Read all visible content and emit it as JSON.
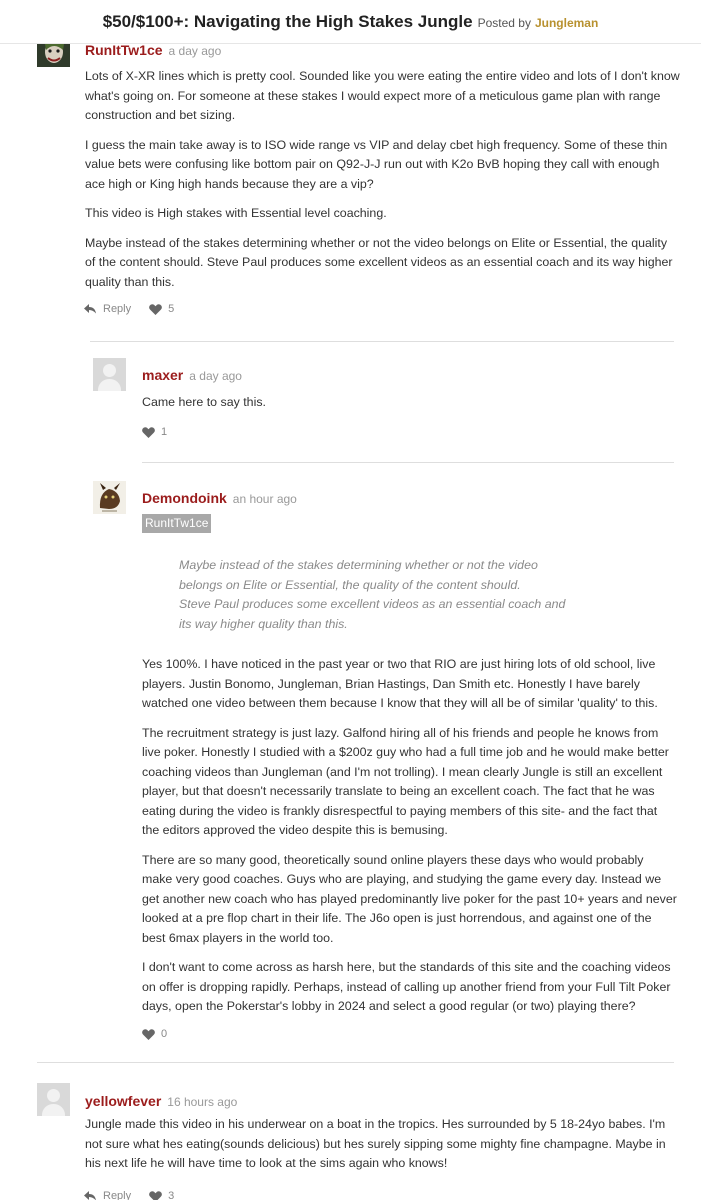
{
  "header": {
    "title": "$50/$100+: Navigating the High Stakes Jungle",
    "posted_by": "Posted by",
    "author": "Jungleman"
  },
  "comments": [
    {
      "user": "RunItTw1ce",
      "time": "a day ago",
      "paragraphs": [
        "Lots of X-XR lines which is pretty cool. Sounded like you were eating the entire video and lots of I don't know what's going on. For someone at these stakes I would expect more of a meticulous game plan with range construction and bet sizing.",
        "I guess the main take away is to ISO wide range vs VIP and delay cbet high frequency. Some of these thin value bets were confusing like bottom pair on Q92-J-J run out with K2o BvB hoping they call with enough ace high or King high hands because they are a vip?",
        "This video is High stakes with Essential level coaching.",
        "Maybe instead of the stakes determining whether or not the video belongs on Elite or Essential, the quality of the content should. Steve Paul produces some excellent videos as an essential coach and its way higher quality than this."
      ],
      "reply_label": "Reply",
      "likes": "5"
    },
    {
      "user": "maxer",
      "time": "a day ago",
      "paragraphs": [
        "Came here to say this."
      ],
      "likes": "1"
    },
    {
      "user": "Demondoink",
      "time": "an hour ago",
      "mention": "RunItTw1ce",
      "quote": [
        "Maybe instead of the stakes determining whether or not the video",
        "belongs on Elite or Essential, the quality of the content should.",
        "Steve Paul produces some excellent videos as an essential coach and",
        "its way higher quality than this."
      ],
      "paragraphs": [
        "Yes 100%. I have noticed in the past year or two that RIO are just hiring lots of old school, live players. Justin Bonomo, Jungleman, Brian Hastings, Dan Smith etc. Honestly I have barely watched one video between them because I know that they will all be of similar 'quality' to this.",
        "The recruitment strategy is just lazy. Galfond hiring all of his friends and people he knows from live poker. Honestly I studied with a $200z guy who had a full time job and he would make better coaching videos than Jungleman (and I'm not trolling). I mean clearly Jungle is still an excellent player, but that doesn't necessarily translate to being an excellent coach. The fact that he was eating during the video is frankly disrespectful to paying members of this site- and the fact that the editors approved the video despite this is bemusing.",
        "There are so many good, theoretically sound online players these days who would probably make very good coaches. Guys who are playing, and studying the game every day. Instead we get another new coach who has played predominantly live poker for the past 10+ years and never looked at a pre flop chart in their life. The J6o open is just horrendous, and against one of the best 6max players in the world too.",
        "I don't want to come across as harsh here, but the standards of this site and the coaching videos on offer is dropping rapidly. Perhaps, instead of calling up another friend from your Full Tilt Poker days, open the Pokerstar's lobby in 2024 and select a good regular (or two) playing there?"
      ],
      "likes": "0"
    },
    {
      "user": "yellowfever",
      "time": "16 hours ago",
      "paragraphs": [
        "Jungle made this video in his underwear on a boat in the tropics. Hes surrounded by 5 18-24yo babes. I'm not sure what hes eating(sounds delicious) but hes surely sipping some mighty fine champagne. Maybe in his next life he will have time to look at the sims again who knows!"
      ],
      "reply_label": "Reply",
      "likes": "3"
    }
  ],
  "colors": {
    "username": "#9b1c1c",
    "author": "#b8912f",
    "mention_bg": "#a8a8a8"
  }
}
